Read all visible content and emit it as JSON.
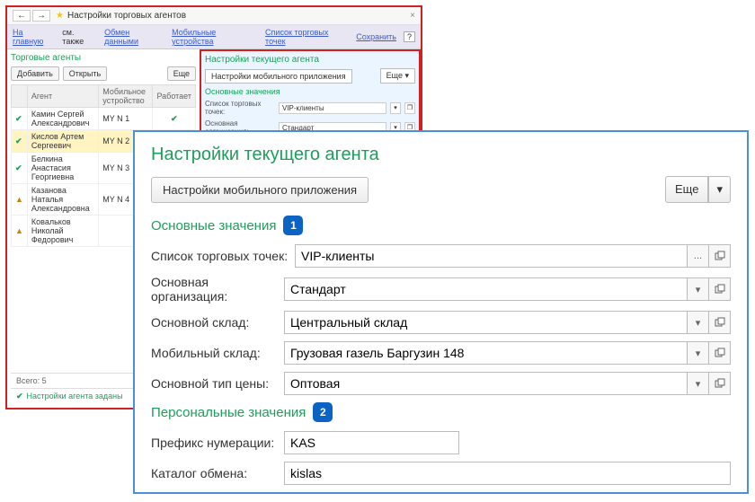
{
  "bg": {
    "title": "Настройки торговых агентов",
    "nav": {
      "back": "←",
      "fwd": "→"
    },
    "links": {
      "home": "На главную",
      "also": "см. также",
      "exchange": "Обмен данными",
      "devices": "Мобильные устройства",
      "points": "Список торговых точек",
      "save": "Сохранить",
      "help": "?"
    },
    "leftHeading": "Торговые агенты",
    "btnAdd": "Добавить",
    "btnOpen": "Открыть",
    "btnMore": "Еще",
    "cols": {
      "agent": "Агент",
      "device": "Мобильное устройство",
      "works": "Работает"
    },
    "rows": [
      {
        "status": "ok",
        "name": "Камин Сергей Александрович",
        "device": "MY N 1",
        "works": true
      },
      {
        "status": "ok",
        "name": "Кислов Артем Сергеевич",
        "device": "MY N 2",
        "works": true,
        "sel": true
      },
      {
        "status": "ok",
        "name": "Белкина Анастасия Георгиевна",
        "device": "MY N 3",
        "works": true
      },
      {
        "status": "warn",
        "name": "Казанова Наталья Александровна",
        "device": "MY N 4",
        "works": true
      },
      {
        "status": "warn",
        "name": "Ковальков Николай Федорович",
        "device": "",
        "works": false
      }
    ],
    "rightHeading": "Настройки текущего агента",
    "btnMobileSettings": "Настройки мобильного приложения",
    "sectionMain": "Основные значения",
    "miniRows": [
      {
        "lbl": "Список торговых точек:",
        "val": "VIP-клиенты"
      },
      {
        "lbl": "Основная организация:",
        "val": "Стандарт"
      },
      {
        "lbl": "Основной склад:",
        "val": "Центральный склад"
      },
      {
        "lbl": "Мобильный склад:",
        "val": "Грузовая газель Баргузин 148"
      }
    ],
    "footer": "Всего: 5",
    "status": "Настройки агента заданы"
  },
  "fg": {
    "title": "Настройки текущего агента",
    "btnMobileSettings": "Настройки мобильного приложения",
    "btnMore": "Еще",
    "section1": "Основные значения",
    "badge1": "1",
    "section2": "Персональные значения",
    "badge2": "2",
    "labels": {
      "points": "Список торговых точек:",
      "org": "Основная организация:",
      "warehouse": "Основной склад:",
      "mobile": "Мобильный склад:",
      "price": "Основной тип цены:",
      "prefix": "Префикс нумерации:",
      "catalog": "Каталог обмена:"
    },
    "values": {
      "points": "VIP-клиенты",
      "org": "Стандарт",
      "warehouse": "Центральный склад",
      "mobile": "Грузовая газель Баргузин 148",
      "price": "Оптовая",
      "prefix": "KAS",
      "catalog": "kislas"
    },
    "ellipsis": "...",
    "caret": "▾"
  }
}
